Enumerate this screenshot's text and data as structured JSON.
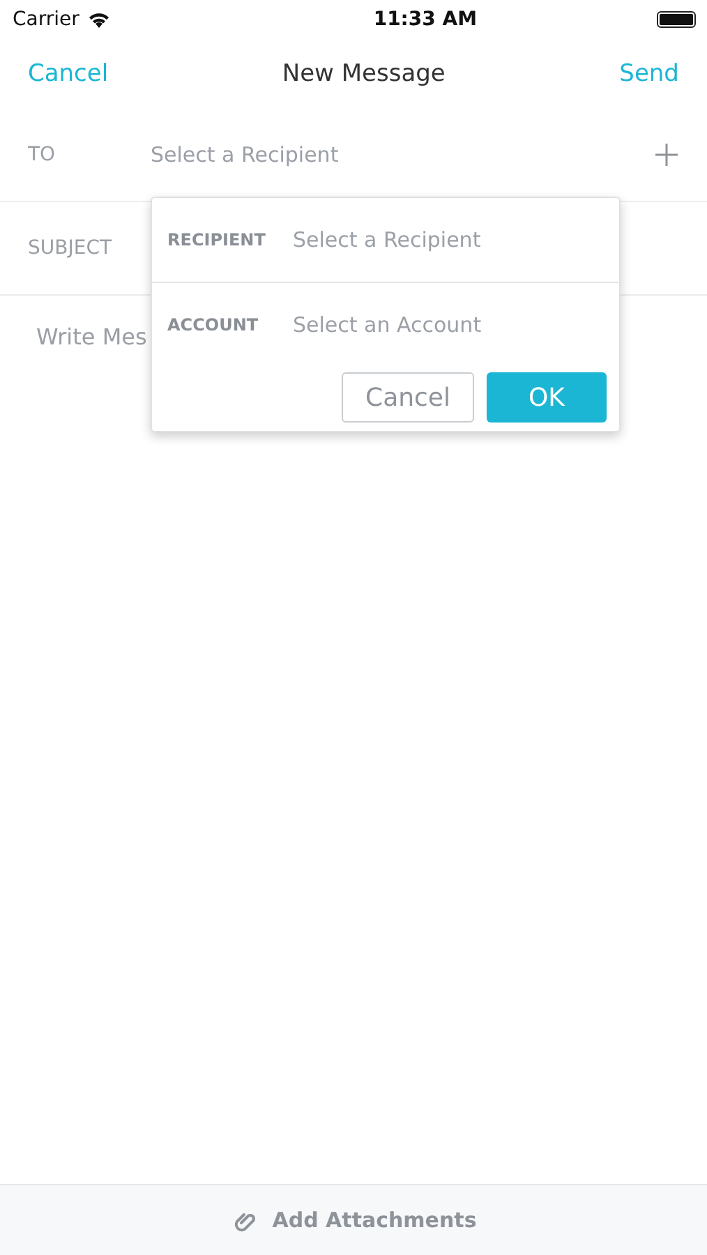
{
  "status_bar": {
    "carrier": "Carrier",
    "time": "11:33 AM"
  },
  "nav": {
    "cancel": "Cancel",
    "title": "New Message",
    "send": "Send"
  },
  "to": {
    "label": "TO",
    "placeholder": "Select a Recipient"
  },
  "subject": {
    "label": "SUBJECT"
  },
  "body": {
    "placeholder": "Write Mes"
  },
  "popover": {
    "fields": [
      {
        "label": "RECIPIENT",
        "placeholder": "Select a Recipient"
      },
      {
        "label": "ACCOUNT",
        "placeholder": "Select an Account"
      }
    ],
    "cancel": "Cancel",
    "ok": "OK"
  },
  "footer": {
    "label": "Add Attachments"
  }
}
